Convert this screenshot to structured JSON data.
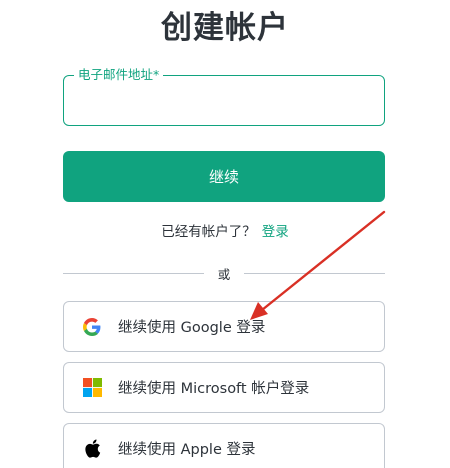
{
  "page": {
    "title": "创建帐户"
  },
  "email": {
    "label": "电子邮件地址*",
    "value": "",
    "placeholder": ""
  },
  "continue_button": {
    "label": "继续"
  },
  "login_prompt": {
    "text": "已经有帐户了？",
    "link": "登录"
  },
  "divider": {
    "text": "或"
  },
  "social": [
    {
      "label": "继续使用 Google 登录",
      "icon": "google-icon"
    },
    {
      "label": "继续使用 Microsoft 帐户登录",
      "icon": "microsoft-icon"
    },
    {
      "label": "继续使用 Apple 登录",
      "icon": "apple-icon"
    }
  ],
  "colors": {
    "accent": "#10a37f",
    "border": "#c2c8d0",
    "annotation_arrow": "#d93025"
  }
}
